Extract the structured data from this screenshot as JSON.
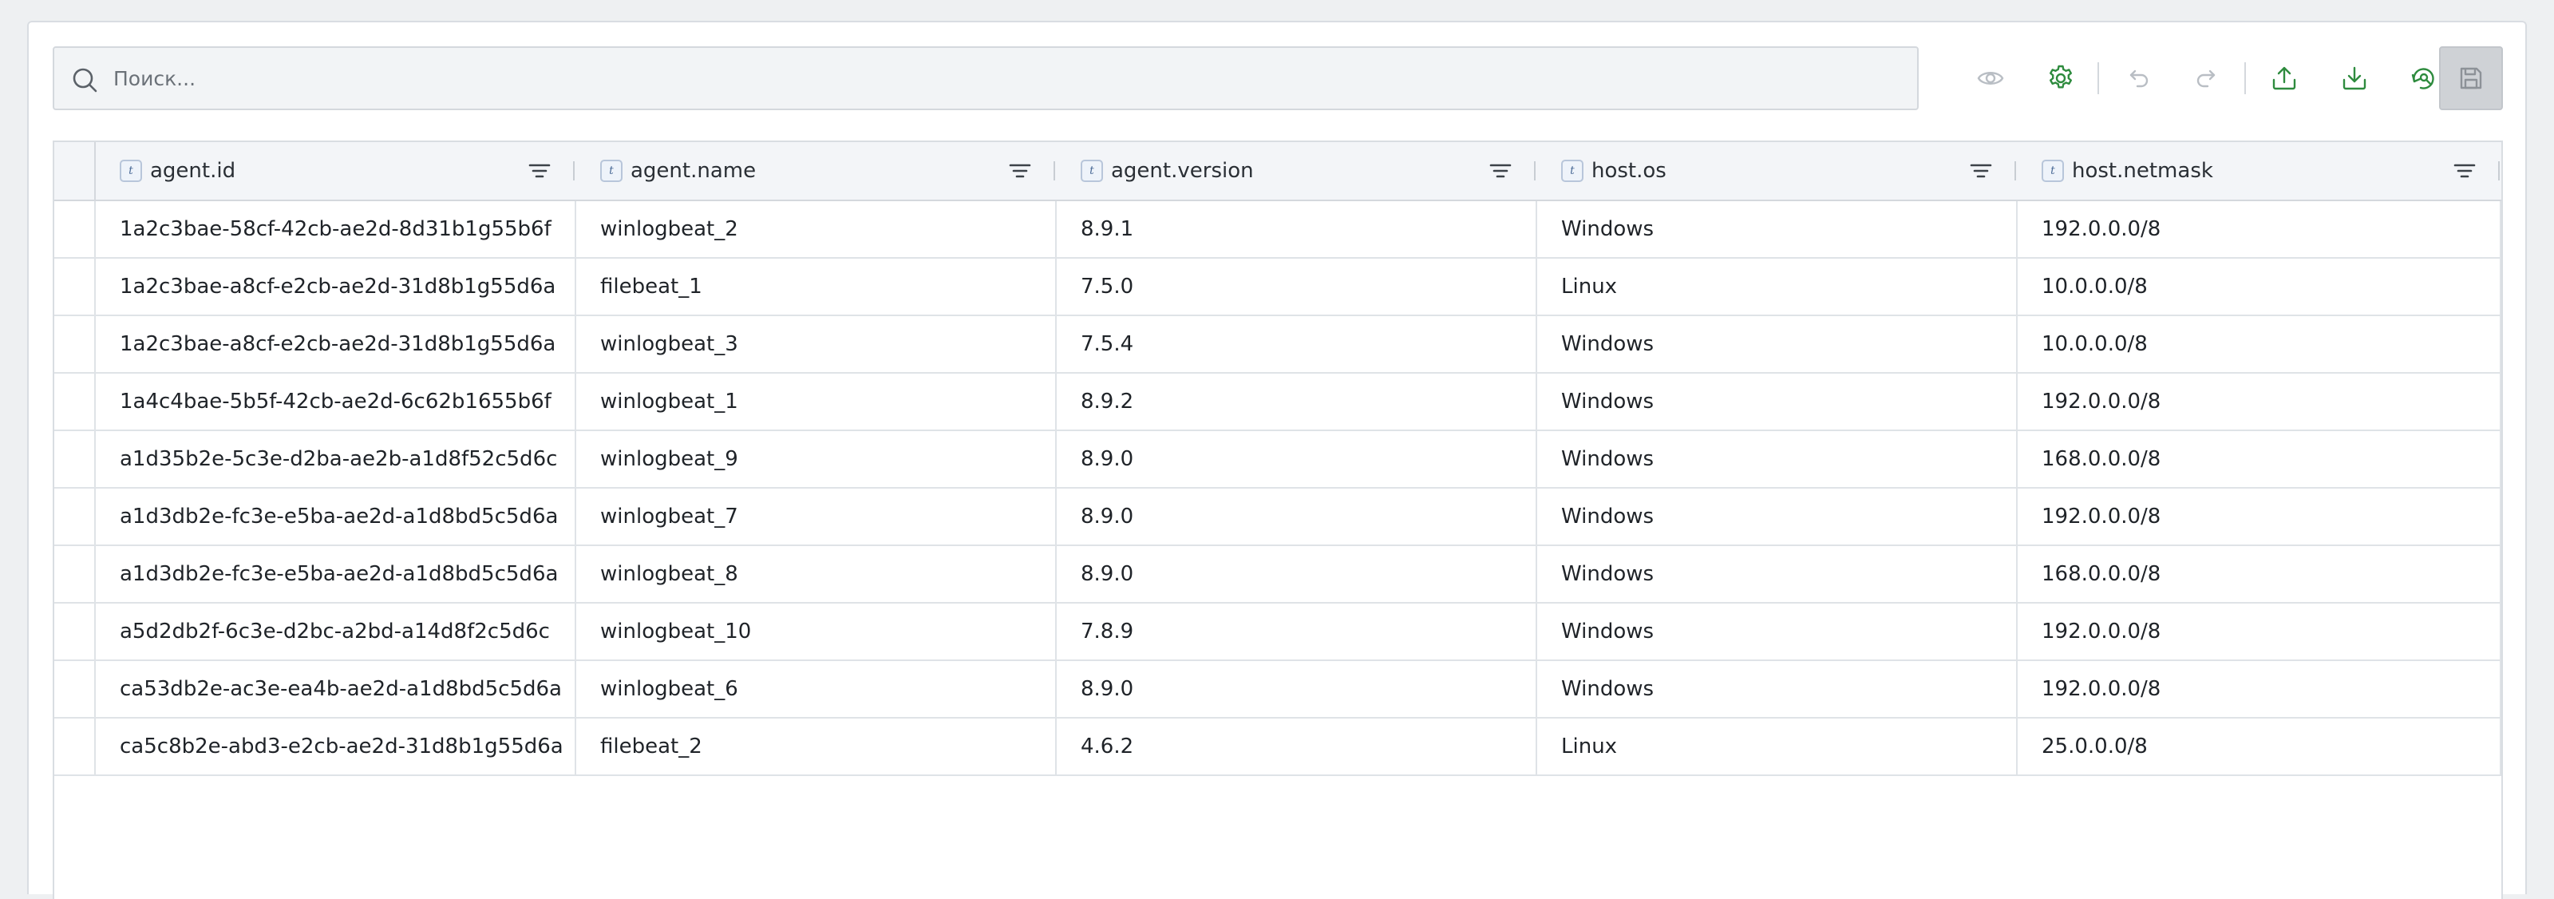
{
  "search": {
    "placeholder": "Поиск...",
    "value": ""
  },
  "toolbar": {
    "buttons": [
      {
        "name": "visibility",
        "icon": "eye-icon",
        "state": "disabled"
      },
      {
        "name": "settings",
        "icon": "gear-icon",
        "state": "enabled"
      },
      {
        "name": "undo",
        "icon": "undo-icon",
        "state": "disabled"
      },
      {
        "name": "redo",
        "icon": "redo-icon",
        "state": "disabled"
      },
      {
        "name": "upload",
        "icon": "upload-icon",
        "state": "enabled"
      },
      {
        "name": "download",
        "icon": "download-icon",
        "state": "enabled"
      },
      {
        "name": "refresh-search",
        "icon": "refresh-search-icon",
        "state": "enabled"
      },
      {
        "name": "save",
        "icon": "save-icon",
        "state": "disabled"
      }
    ]
  },
  "colors": {
    "accent": "#2e8b3e",
    "disabled_icon": "#b9bec4",
    "header_bg": "#f3f5f8"
  },
  "table": {
    "columns": [
      {
        "key": "agent_id",
        "label": "agent.id",
        "type_badge": "t"
      },
      {
        "key": "agent_name",
        "label": "agent.name",
        "type_badge": "t"
      },
      {
        "key": "agent_version",
        "label": "agent.version",
        "type_badge": "t"
      },
      {
        "key": "host_os",
        "label": "host.os",
        "type_badge": "t"
      },
      {
        "key": "host_netmask",
        "label": "host.netmask",
        "type_badge": "t"
      }
    ],
    "rows": [
      [
        "1a2c3bae-58cf-42cb-ae2d-8d31b1g55b6f",
        "winlogbeat_2",
        "8.9.1",
        "Windows",
        "192.0.0.0/8"
      ],
      [
        "1a2c3bae-a8cf-e2cb-ae2d-31d8b1g55d6a",
        "filebeat_1",
        "7.5.0",
        "Linux",
        "10.0.0.0/8"
      ],
      [
        "1a2c3bae-a8cf-e2cb-ae2d-31d8b1g55d6a",
        "winlogbeat_3",
        "7.5.4",
        "Windows",
        "10.0.0.0/8"
      ],
      [
        "1a4c4bae-5b5f-42cb-ae2d-6c62b1655b6f",
        "winlogbeat_1",
        "8.9.2",
        "Windows",
        "192.0.0.0/8"
      ],
      [
        "a1d35b2e-5c3e-d2ba-ae2b-a1d8f52c5d6c",
        "winlogbeat_9",
        "8.9.0",
        "Windows",
        "168.0.0.0/8"
      ],
      [
        "a1d3db2e-fc3e-e5ba-ae2d-a1d8bd5c5d6a",
        "winlogbeat_7",
        "8.9.0",
        "Windows",
        "192.0.0.0/8"
      ],
      [
        "a1d3db2e-fc3e-e5ba-ae2d-a1d8bd5c5d6a",
        "winlogbeat_8",
        "8.9.0",
        "Windows",
        "168.0.0.0/8"
      ],
      [
        "a5d2db2f-6c3e-d2bc-a2bd-a14d8f2c5d6c",
        "winlogbeat_10",
        "7.8.9",
        "Windows",
        "192.0.0.0/8"
      ],
      [
        "ca53db2e-ac3e-ea4b-ae2d-a1d8bd5c5d6a",
        "winlogbeat_6",
        "8.9.0",
        "Windows",
        "192.0.0.0/8"
      ],
      [
        "ca5c8b2e-abd3-e2cb-ae2d-31d8b1g55d6a",
        "filebeat_2",
        "4.6.2",
        "Linux",
        "25.0.0.0/8"
      ]
    ]
  }
}
